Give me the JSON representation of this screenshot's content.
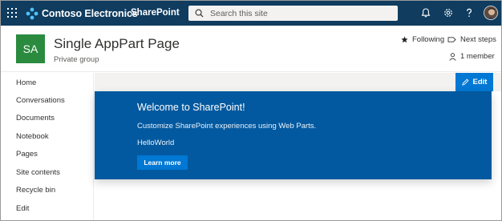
{
  "suite_bar": {
    "brand_name": "Contoso Electronics",
    "app_name": "SharePoint",
    "search_placeholder": "Search this site",
    "colors": {
      "background": "#0f3c5f",
      "search_bg": "#f3f2f1"
    },
    "icons": [
      "app-launcher-icon",
      "contoso-logo-icon",
      "search-icon",
      "bell-icon",
      "gear-icon",
      "help-icon",
      "user-avatar"
    ]
  },
  "site_header": {
    "logo_initials": "SA",
    "logo_color": "#2a8a3e",
    "title": "Single AppPart Page",
    "subtitle": "Private group",
    "following_label": "Following",
    "next_steps_label": "Next steps",
    "members_label": "1 member"
  },
  "left_nav": {
    "items": [
      {
        "label": "Home"
      },
      {
        "label": "Conversations"
      },
      {
        "label": "Documents"
      },
      {
        "label": "Notebook"
      },
      {
        "label": "Pages"
      },
      {
        "label": "Site contents"
      },
      {
        "label": "Recycle bin"
      },
      {
        "label": "Edit"
      }
    ]
  },
  "command_bar": {
    "edit_label": "Edit",
    "accent": "#0078d4"
  },
  "hero": {
    "title": "Welcome to SharePoint!",
    "description": "Customize SharePoint experiences using Web Parts.",
    "webpart_text": "HelloWorld",
    "button_label": "Learn more",
    "background": "#03599f"
  }
}
